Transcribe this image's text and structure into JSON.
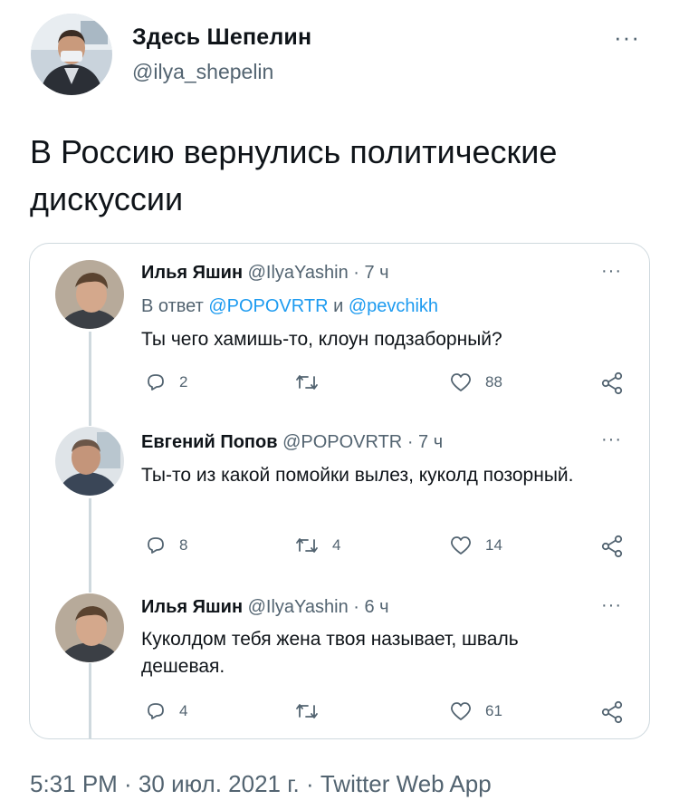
{
  "tweet": {
    "author": {
      "name": "Здесь Шепелин",
      "handle": "@ilya_shepelin"
    },
    "more_label": "···",
    "text": "В Россию вернулись политические дискуссии",
    "meta": "5:31 PM · 30 июл. 2021 г. · Twitter Web App"
  },
  "quoted_thread": [
    {
      "name": "Илья Яшин",
      "handle": "@IlyaYashin",
      "time": "· 7 ч",
      "reply_to": {
        "prefix": "В ответ",
        "mention1": "@POPOVRTR",
        "joiner": "и",
        "mention2": "@pevchikh"
      },
      "text": "Ты чего хамишь-то, клоун подзаборный?",
      "replies": "2",
      "retweets": "",
      "likes": "88"
    },
    {
      "name": "Евгений Попов",
      "handle": "@POPOVRTR",
      "time": "· 7 ч",
      "text": "Ты-то из какой помойки вылез, куколд позорный.",
      "replies": "8",
      "retweets": "4",
      "likes": "14"
    },
    {
      "name": "Илья Яшин",
      "handle": "@IlyaYashin",
      "time": "· 6 ч",
      "text": "Куколдом тебя жена твоя называет, шваль дешевая.",
      "replies": "4",
      "retweets": "",
      "likes": "61"
    }
  ],
  "colors": {
    "text": "#0f1419",
    "secondary": "#536471",
    "link": "#1d9bf0",
    "border": "#cfd9de"
  },
  "icons": [
    "reply-icon",
    "retweet-icon",
    "like-icon",
    "share-icon",
    "more-icon"
  ]
}
